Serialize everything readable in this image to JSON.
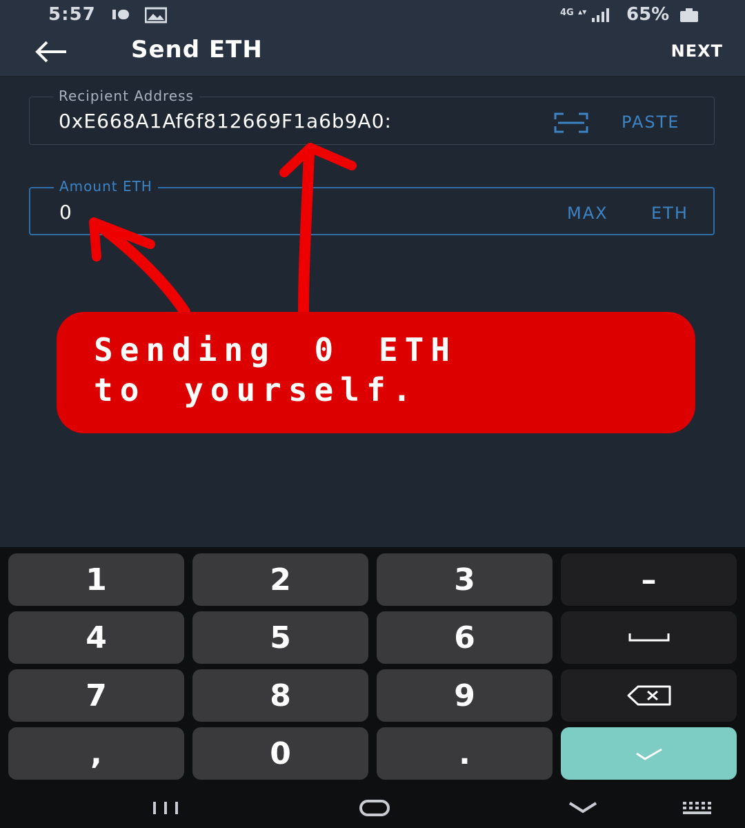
{
  "status_bar": {
    "time": "5:57",
    "network": "4G",
    "battery": "65%"
  },
  "app_bar": {
    "title": "Send ETH",
    "next_label": "NEXT"
  },
  "recipient": {
    "label": "Recipient Address",
    "value": "0xE668A1Af6f812669F1a6b9A0:",
    "paste_label": "PASTE"
  },
  "amount": {
    "label": "Amount ETH",
    "value": "0",
    "max_label": "MAX",
    "unit_label": "ETH"
  },
  "annotation": {
    "line1": "Sending 0 ETH",
    "line2": "to yourself.",
    "color": "#dd0000"
  },
  "keypad": {
    "keys": [
      "1",
      "2",
      "3",
      "4",
      "5",
      "6",
      "7",
      "8",
      "9",
      ",",
      "0",
      "."
    ],
    "minus": "–",
    "confirm_color": "#7ecdc4"
  },
  "colors": {
    "background": "#1f2733",
    "accent": "#3d84c4"
  }
}
